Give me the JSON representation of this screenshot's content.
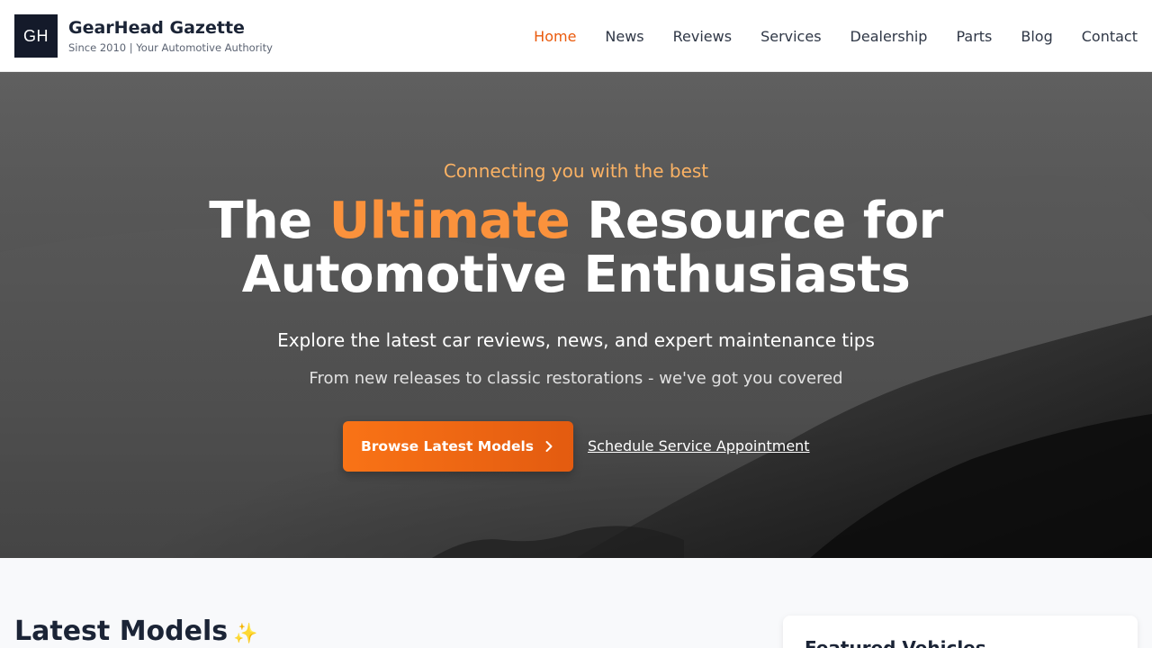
{
  "header": {
    "logo_text": "GH",
    "brand_name": "GearHead Gazette",
    "brand_tagline": "Since 2010 | Your Automotive Authority",
    "nav": [
      {
        "label": "Home",
        "active": true
      },
      {
        "label": "News",
        "active": false
      },
      {
        "label": "Reviews",
        "active": false
      },
      {
        "label": "Services",
        "active": false
      },
      {
        "label": "Dealership",
        "active": false
      },
      {
        "label": "Parts",
        "active": false
      },
      {
        "label": "Blog",
        "active": false
      },
      {
        "label": "Contact",
        "active": false
      }
    ]
  },
  "hero": {
    "kicker": "Connecting you with the best",
    "headline_part1": "The ",
    "headline_highlight": "Ultimate",
    "headline_part2": " Resource for",
    "headline_line2": "Automotive Enthusiasts",
    "subtitle": "Explore the latest car reviews, news, and expert maintenance tips",
    "subtitle2": "From new releases to classic restorations - we've got you covered",
    "cta_label": "Browse Latest Models",
    "cta_icon": "chevron-right-icon",
    "secondary_link": "Schedule Service Appointment"
  },
  "latest": {
    "title": "Latest Models",
    "emoji": "✨"
  },
  "sidebar": {
    "featured_title": "Featured Vehicles"
  },
  "colors": {
    "accent": "#f97316",
    "accent_dark": "#ea5a0c",
    "highlight": "#fb923c",
    "kicker": "#fbb264",
    "navy": "#141a2a"
  }
}
